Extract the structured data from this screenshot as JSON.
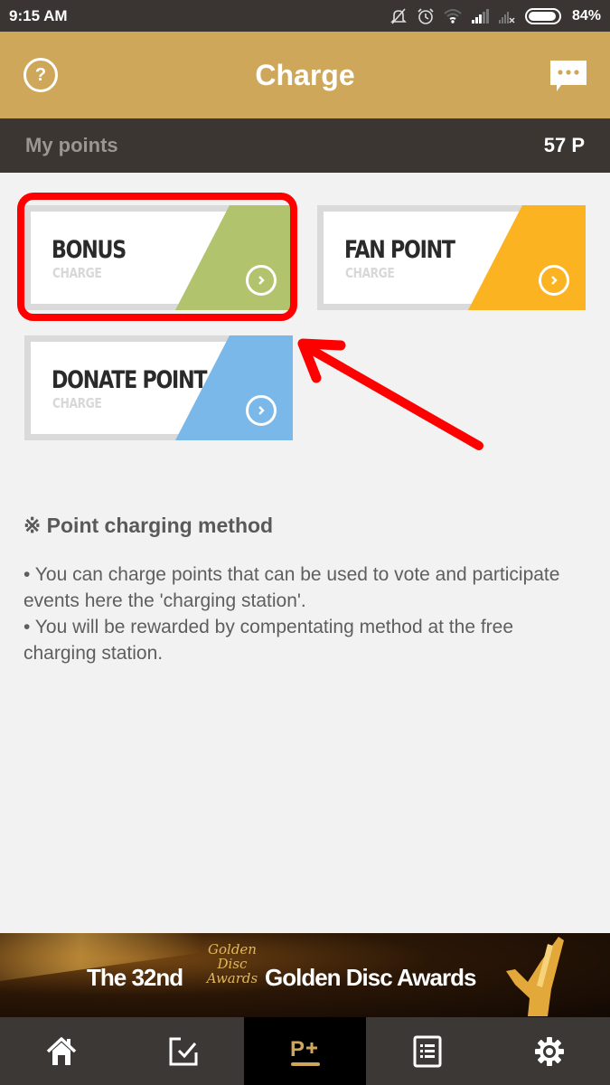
{
  "status_bar": {
    "time": "9:15 AM",
    "icons": [
      "notifications-off-icon",
      "alarm-icon",
      "wifi-icon",
      "signal-icon",
      "signal-no-sim-icon",
      "battery-icon"
    ],
    "battery_percent": "84%"
  },
  "header": {
    "title": "Charge",
    "left_icon": "help-icon",
    "right_icon": "chat-icon"
  },
  "points": {
    "label": "My points",
    "value": "57 P"
  },
  "cards": [
    {
      "title": "BONUS",
      "subtitle": "CHARGE",
      "accent": "#b1c36c",
      "highlighted": true
    },
    {
      "title": "FAN POINT",
      "subtitle": "CHARGE",
      "accent": "#fbb321"
    },
    {
      "title": "DONATE POINT",
      "subtitle": "CHARGE",
      "accent": "#7ab8ea"
    }
  ],
  "annotation": {
    "highlight_color": "#ff0000"
  },
  "info": {
    "title": "※ Point charging method",
    "lines": [
      "• You can charge points that can be used to vote and participate events here the 'charging station'.",
      "• You will be rewarded by compentating method at the free charging station."
    ]
  },
  "banner": {
    "text_a": "The 32nd",
    "logo": "Golden Disc Awards",
    "text_b": "Golden Disc Awards"
  },
  "bottom_nav": {
    "items": [
      {
        "name": "home",
        "icon": "home-icon"
      },
      {
        "name": "vote",
        "icon": "checkbox-icon"
      },
      {
        "name": "charge",
        "icon": "points-plus-icon",
        "label": "P+",
        "active": true
      },
      {
        "name": "list",
        "icon": "list-icon"
      },
      {
        "name": "settings",
        "icon": "gear-icon"
      }
    ],
    "active_color": "#cfa75b"
  }
}
